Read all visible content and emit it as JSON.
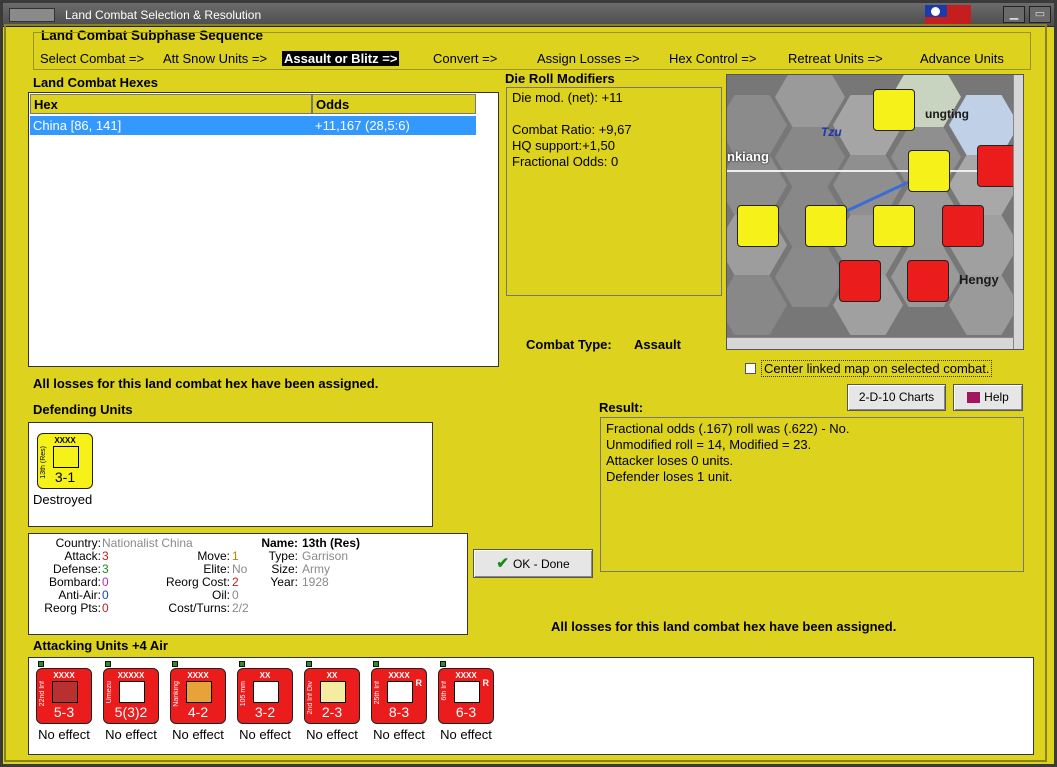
{
  "window": {
    "title": "Land Combat Selection & Resolution"
  },
  "sequence": {
    "heading": "Land Combat Subphase Sequence",
    "steps": [
      "Select Combat =>",
      "Att Snow Units =>",
      "Assault or Blitz =>",
      "Convert =>",
      "Assign Losses =>",
      "Hex Control =>",
      "Retreat Units =>",
      "Advance Units"
    ]
  },
  "hexes": {
    "heading": "Land Combat Hexes",
    "columns": [
      "Hex",
      "Odds"
    ],
    "rows": [
      {
        "hex": "China [86, 141]",
        "odds": "+11,167 (28,5:6)"
      }
    ],
    "status": "All losses for this land combat hex have been assigned."
  },
  "drm": {
    "heading": "Die Roll Modifiers",
    "lines": [
      "Die mod. (net): +11",
      "",
      "Combat Ratio: +9,67",
      "HQ support:+1,50",
      "Fractional Odds: 0"
    ]
  },
  "combat_type": {
    "label": "Combat Type:",
    "value": "Assault"
  },
  "map": {
    "labels": {
      "tzu": "Tzu",
      "kiang": "nkiang",
      "tung": "ungting",
      "hengy": "Hengy"
    },
    "center_linked": "Center linked map on selected combat."
  },
  "buttons": {
    "charts": "2-D-10 Charts",
    "help": "Help",
    "ok": "OK - Done"
  },
  "result": {
    "heading": "Result:",
    "lines": [
      "Fractional odds (.167) roll was (.622)  - No.",
      "Unmodified roll = 14, Modified = 23.",
      "Attacker loses 0 units.",
      "Defender loses 1 unit."
    ]
  },
  "defending": {
    "heading": "Defending Units",
    "units": [
      {
        "name": "13th (Res)",
        "size": "XXXX",
        "value": "3-1",
        "status": "Destroyed"
      }
    ]
  },
  "unit_info": {
    "country_label": "Country:",
    "country": "Nationalist China",
    "attack_label": "Attack:",
    "attack": "3",
    "defense_label": "Defense:",
    "defense": "3",
    "bombard_label": "Bombard:",
    "bombard": "0",
    "antiair_label": "Anti-Air:",
    "antiair": "0",
    "reorg_label": "Reorg Pts:",
    "reorg": "0",
    "move_label": "Move:",
    "move": "1",
    "elite_label": "Elite:",
    "elite": "No",
    "reorgcost_label": "Reorg Cost:",
    "reorgcost": "2",
    "oil_label": "Oil:",
    "oil": "0",
    "cost_label": "Cost/Turns:",
    "cost": "2/2",
    "name_label": "Name:",
    "name": "13th (Res)",
    "type_label": "Type:",
    "type": "Garrison",
    "size_label": "Size:",
    "size": "Army",
    "year_label": "Year:",
    "year": "1928"
  },
  "attacking": {
    "heading": "Attacking Units +4 Air",
    "status": "All losses for this land combat hex have been assigned.",
    "units": [
      {
        "name": "22nd Inf",
        "size": "XXXX",
        "value": "5-3",
        "status": "No effect",
        "color": "red"
      },
      {
        "name": "Umezu",
        "size": "XXXXX",
        "value": "5(3)2",
        "status": "No effect",
        "color": "red"
      },
      {
        "name": "Nanking",
        "size": "XXXX",
        "value": "4-2",
        "status": "No effect",
        "color": "red"
      },
      {
        "name": "105 mm",
        "size": "XX",
        "value": "3-2",
        "status": "No effect",
        "color": "red"
      },
      {
        "name": "2nd Inf Div",
        "size": "XX",
        "value": "2-3",
        "status": "No effect",
        "color": "red"
      },
      {
        "name": "25th Inf",
        "size": "XXXX",
        "value": "8-3",
        "status": "No effect",
        "color": "red"
      },
      {
        "name": "6th Inf",
        "size": "XXXX",
        "value": "6-3",
        "status": "No effect",
        "color": "red"
      }
    ]
  },
  "colors": {
    "panel": "#ddd21d",
    "selection": "#3399ff",
    "red_counter": "#ea1c1c",
    "yellow_counter": "#f7f11a"
  }
}
